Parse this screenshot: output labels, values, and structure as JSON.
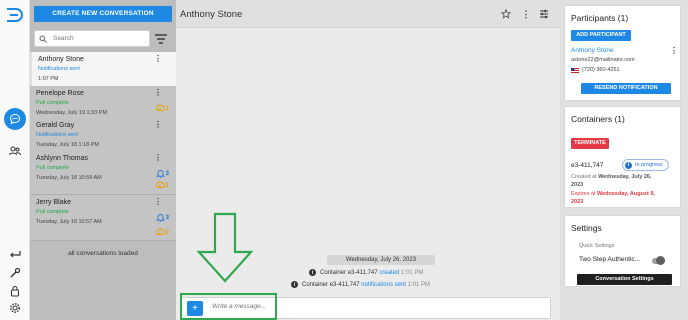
{
  "header": {
    "contact_name": "Anthony Stone"
  },
  "sidebar": {
    "create_label": "CREATE NEW CONVERSATION",
    "search_placeholder": "Search",
    "conversations": [
      {
        "name": "Anthony Stone",
        "status": "Notifications sent",
        "time": "1:07 PM"
      },
      {
        "name": "Penelope Rose",
        "status": "Pull complete",
        "time": "Wednesday, July 19 1:33 PM",
        "badge_orange": "1"
      },
      {
        "name": "Gerald Gray",
        "status": "Notifications sent",
        "time": "Tuesday, July 18 1:18 PM"
      },
      {
        "name": "Ashlynn Thomas",
        "status": "Pull complete",
        "time": "Tuesday, July 18 10:59 AM",
        "badge_blue": "3",
        "badge_orange": "1"
      },
      {
        "name": "Jerry Blake",
        "status": "Pull complete",
        "time": "Tuesday, July 18 10:57 AM",
        "badge_blue": "3",
        "badge_orange": "2"
      }
    ],
    "loaded_text": "all conversations loaded"
  },
  "chat": {
    "date_divider": "Wednesday, July 26, 2023",
    "events": [
      {
        "prefix": "Container",
        "container_id": "e3-411,747",
        "action": "created",
        "time": "1:01 PM"
      },
      {
        "prefix": "Container",
        "container_id": "e3-411,747",
        "action": "notifications sent",
        "time": "1:01 PM"
      }
    ],
    "composer_placeholder": "Write a message..."
  },
  "participants": {
    "title": "Participants (1)",
    "add_label": "ADD PARTICIPANT",
    "name": "Anthony Stone",
    "email": "astone22@mailinator.com",
    "phone": "(720) 360-4261",
    "resend_label": "RESEND NOTIFICATION"
  },
  "containers": {
    "title": "Containers (1)",
    "terminate_label": "TERMINATE",
    "container_id": "e3-411,747",
    "status": "In progress",
    "created_label": "Created at",
    "created_date_line1": "Wednesday, July 26,",
    "created_date_line2": "2023",
    "expires_label": "Expires at",
    "expires_date_line1": "Wednesday, August 9,",
    "expires_date_line2": "2023"
  },
  "settings": {
    "title": "Settings",
    "quick_label": "Quick Settings",
    "two_step_label": "Two Step Authentic...",
    "conversation_settings_label": "Conversation Settings"
  },
  "colors": {
    "primary": "#1e88e5",
    "danger": "#e53945",
    "success_status": "#1fa84a",
    "annotation": "#2fa84f"
  }
}
